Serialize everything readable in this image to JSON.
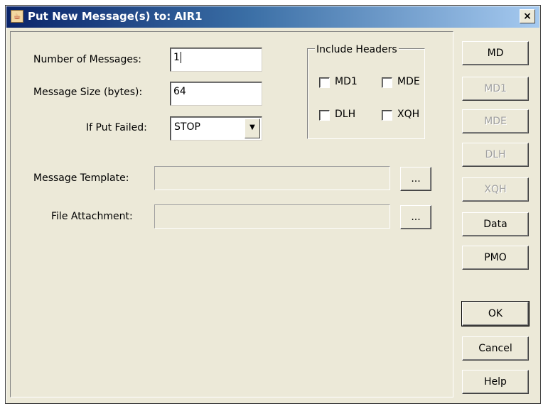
{
  "window": {
    "title": "Put New Message(s) to: AIR1",
    "app_icon": "java-cup-icon",
    "close_label": "×"
  },
  "form": {
    "num_messages_label": "Number of Messages:",
    "num_messages_value": "1",
    "msg_size_label": "Message Size (bytes):",
    "msg_size_value": "64",
    "put_failed_label": "If Put Failed:",
    "put_failed_value": "STOP",
    "template_label": "Message Template:",
    "template_value": "",
    "template_browse": "...",
    "attachment_label": "File Attachment:",
    "attachment_value": "",
    "attachment_browse": "..."
  },
  "headers": {
    "title": "Include Headers",
    "md1": "MD1",
    "mde": "MDE",
    "dlh": "DLH",
    "xqh": "XQH"
  },
  "buttons": {
    "md": "MD",
    "md1": "MD1",
    "mde": "MDE",
    "dlh": "DLH",
    "xqh": "XQH",
    "data": "Data",
    "pmo": "PMO",
    "ok": "OK",
    "cancel": "Cancel",
    "help": "Help"
  }
}
